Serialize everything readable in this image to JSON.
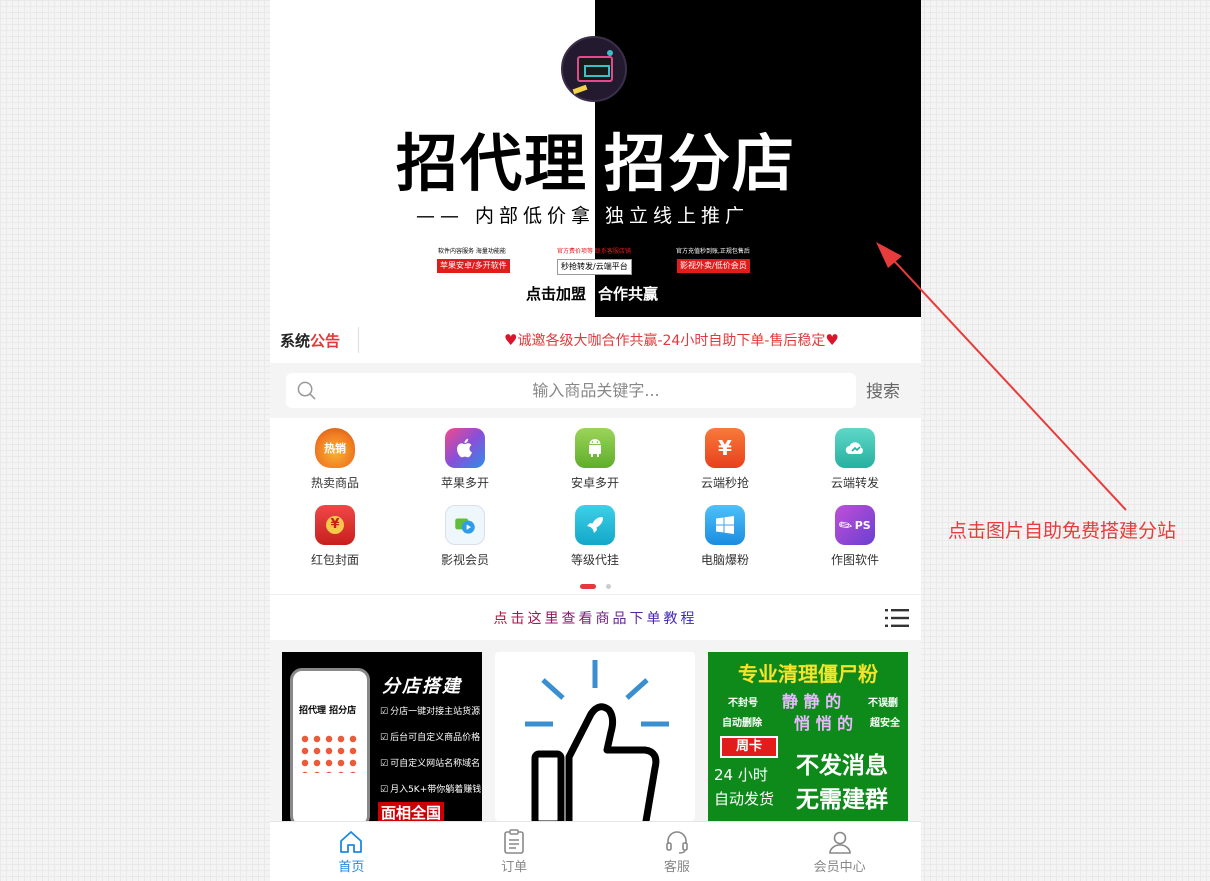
{
  "banner": {
    "headline_left": "招代理",
    "headline_right": "招分店",
    "subtitle_left": "—— 内部低价拿货",
    "subtitle_right": "独立线上推广",
    "small1": "软件内容服务 海量功能能",
    "small2": "官方费价项等 联系客服店铺",
    "small3": "官方充值秒到账,正规包售后",
    "tag1": "苹果安卓/多开软件",
    "tag2": "秒抢转发/云端平台",
    "tag3": "影视外卖/低价会员",
    "cta_left": "点击加盟",
    "cta_right": "合作共赢"
  },
  "notice": {
    "title_black": "系统",
    "title_red": "公告",
    "text": "诚邀各级大咖合作共赢-24小时自助下单-售后稳定"
  },
  "search": {
    "placeholder": "输入商品关键字...",
    "button": "搜索"
  },
  "categories": [
    {
      "label": "热卖商品",
      "icon": "hot-sale-icon",
      "glyph": "热销",
      "color": "#f07a22"
    },
    {
      "label": "苹果多开",
      "icon": "apple-icon",
      "glyph": "",
      "color": "#c948c9"
    },
    {
      "label": "安卓多开",
      "icon": "android-icon",
      "glyph": "",
      "color": "#7cc242"
    },
    {
      "label": "云端秒抢",
      "icon": "cloud-grab-icon",
      "glyph": "¥",
      "color": "#f2562d"
    },
    {
      "label": "云端转发",
      "icon": "cloud-forward-icon",
      "glyph": "",
      "color": "#3cc6b4"
    },
    {
      "label": "红包封面",
      "icon": "red-envelope-icon",
      "glyph": "¥",
      "color": "#e03030"
    },
    {
      "label": "影视会员",
      "icon": "video-member-icon",
      "glyph": "",
      "color": "#4bb8e8"
    },
    {
      "label": "等级代挂",
      "icon": "rocket-icon",
      "glyph": "",
      "color": "#22b8d8"
    },
    {
      "label": "电脑爆粉",
      "icon": "windows-icon",
      "glyph": "",
      "color": "#2fa6e8"
    },
    {
      "label": "作图软件",
      "icon": "ps-icon",
      "glyph": "PS",
      "color": "#8a4fd8"
    }
  ],
  "tutorial": {
    "text": "点击这里查看商品下单教程",
    "gradient_from": "#b5133c",
    "gradient_to": "#3a2cc0"
  },
  "products": {
    "card1": {
      "title": "分店搭建",
      "phone_title": "招代理 招分店",
      "features": [
        "分店一键对接主站货源",
        "后台可自定义商品价格",
        "可自定义网站名称域名",
        "月入5K+带你躺着赚钱"
      ],
      "bottom": "面相全国"
    },
    "card3": {
      "title": "专业清理僵尸粉",
      "no_ban": "不封号",
      "no_delete": "不误删",
      "auto_delete": "自动删除",
      "safe": "超安全",
      "quiet1": "静 静 的",
      "quiet2": "悄 悄 的",
      "week": "周卡",
      "h24": "24 小时",
      "auto_ship": "自动发货",
      "no_msg": "不发消息",
      "no_group": "无需建群"
    }
  },
  "tabbar": [
    {
      "label": "首页",
      "active": true
    },
    {
      "label": "订单",
      "active": false
    },
    {
      "label": "客服",
      "active": false
    },
    {
      "label": "会员中心",
      "active": false
    }
  ],
  "annotation": "点击图片自助免费搭建分站",
  "colors": {
    "accent_red": "#e4393c",
    "active_tab": "#1e88e5",
    "annotation_red": "#e83c3c"
  }
}
